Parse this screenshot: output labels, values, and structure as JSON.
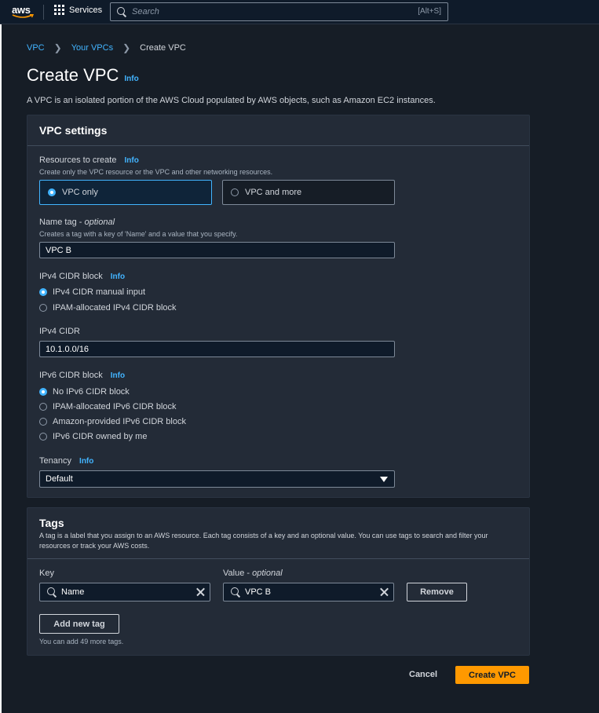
{
  "topnav": {
    "logo_text": "aws",
    "services_label": "Services",
    "search_placeholder": "Search",
    "search_shortcut": "[Alt+S]"
  },
  "breadcrumb": {
    "items": [
      "VPC",
      "Your VPCs"
    ],
    "current": "Create VPC"
  },
  "page": {
    "title": "Create VPC",
    "info_label": "Info",
    "description": "A VPC is an isolated portion of the AWS Cloud populated by AWS objects, such as Amazon EC2 instances."
  },
  "vpc_settings": {
    "heading": "VPC settings",
    "resources": {
      "label": "Resources to create",
      "info": "Info",
      "description": "Create only the VPC resource or the VPC and other networking resources.",
      "options": [
        "VPC only",
        "VPC and more"
      ],
      "selected": "VPC only"
    },
    "name_tag": {
      "label": "Name tag",
      "optional": "optional",
      "separator": " - ",
      "description": "Creates a tag with a key of 'Name' and a value that you specify.",
      "value": "VPC B"
    },
    "ipv4_block": {
      "label": "IPv4 CIDR block",
      "info": "Info",
      "options": [
        "IPv4 CIDR manual input",
        "IPAM-allocated IPv4 CIDR block"
      ],
      "selected": "IPv4 CIDR manual input"
    },
    "ipv4_cidr": {
      "label": "IPv4 CIDR",
      "value": "10.1.0.0/16"
    },
    "ipv6_block": {
      "label": "IPv6 CIDR block",
      "info": "Info",
      "options": [
        "No IPv6 CIDR block",
        "IPAM-allocated IPv6 CIDR block",
        "Amazon-provided IPv6 CIDR block",
        "IPv6 CIDR owned by me"
      ],
      "selected": "No IPv6 CIDR block"
    },
    "tenancy": {
      "label": "Tenancy",
      "info": "Info",
      "value": "Default"
    }
  },
  "tags": {
    "heading": "Tags",
    "description": "A tag is a label that you assign to an AWS resource. Each tag consists of a key and an optional value. You can use tags to search and filter your resources or track your AWS costs.",
    "key_label": "Key",
    "value_label": "Value",
    "value_optional": "optional",
    "key_value": "Name",
    "value_value": "VPC B",
    "remove_label": "Remove",
    "add_label": "Add new tag",
    "hint": "You can add 49 more tags."
  },
  "footer": {
    "cancel_label": "Cancel",
    "create_label": "Create VPC"
  },
  "colors": {
    "accent": "#42b4ff",
    "primary_button": "#ff9900",
    "background": "#161d26",
    "panel": "#232b37"
  }
}
